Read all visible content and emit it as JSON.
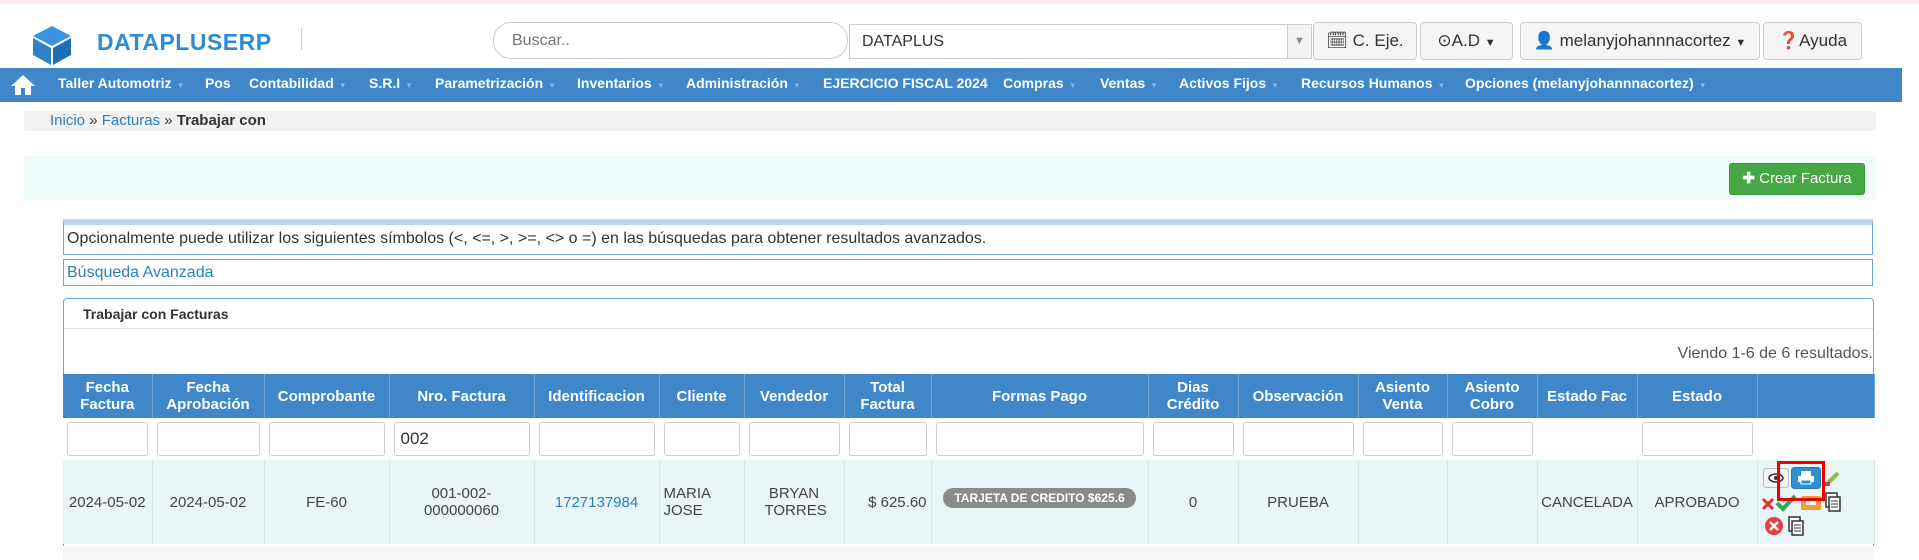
{
  "header": {
    "brand": "DATAPLUSERP",
    "search_placeholder": "Buscar..",
    "company": "DATAPLUS",
    "btn_ejercicio": "C. Eje.",
    "btn_ad": "A.D",
    "btn_user": "melanyjohannnacortez",
    "btn_help": "Ayuda"
  },
  "nav": {
    "items": [
      {
        "label": "Taller Automotriz",
        "caret": true
      },
      {
        "label": "Pos",
        "caret": false
      },
      {
        "label": "Contabilidad",
        "caret": true
      },
      {
        "label": "S.R.I",
        "caret": true
      },
      {
        "label": "Parametrización",
        "caret": true
      },
      {
        "label": "Inventarios",
        "caret": true
      },
      {
        "label": "Administración",
        "caret": true
      },
      {
        "label": "EJERCICIO FISCAL 2024",
        "caret": false
      },
      {
        "label": "Compras",
        "caret": true
      },
      {
        "label": "Ventas",
        "caret": true
      },
      {
        "label": "Activos Fijos",
        "caret": true
      },
      {
        "label": "Recursos Humanos",
        "caret": true
      },
      {
        "label": "Opciones (melanyjohannnacortez)",
        "caret": true
      }
    ]
  },
  "breadcrumb": {
    "home": "Inicio",
    "section": "Facturas",
    "current": "Trabajar con",
    "sep": "»"
  },
  "actions": {
    "create_label": "Crear Factura"
  },
  "hint": "Opcionalmente puede utilizar los siguientes símbolos (<, <=, >, >=, <> o =) en las búsquedas para obtener resultados avanzados.",
  "advanced_search": "Búsqueda Avanzada",
  "panel": {
    "title": "Trabajar con Facturas",
    "summary": "Viendo 1-6 de 6 resultados."
  },
  "table": {
    "headers": [
      "Fecha Factura",
      "Fecha Aprobación",
      "Comprobante",
      "Nro. Factura",
      "Identificacion",
      "Cliente",
      "Vendedor",
      "Total Factura",
      "Formas Pago",
      "Dias Crédito",
      "Observación",
      "Asiento Venta",
      "Asiento Cobro",
      "Estado Fac",
      "Estado",
      ""
    ],
    "filter_nro": "002",
    "rows": [
      {
        "fecha_factura": "2024-05-02",
        "fecha_aprobacion": "2024-05-02",
        "comprobante": "FE-60",
        "nro_factura": "001-002-000000060",
        "identificacion": "1727137984",
        "cliente": "MARIA JOSE",
        "vendedor": "BRYAN TORRES",
        "total": "$ 625.60",
        "formas_pago": "TARJETA DE CREDITO $625.6",
        "dias_credito": "0",
        "observacion": "PRUEBA",
        "asiento_venta": "",
        "asiento_cobro": "",
        "estado_fac": "CANCELADA",
        "estado": "APROBADO"
      }
    ]
  },
  "colors": {
    "brand": "#2e8bd6",
    "nav": "#3f87c8",
    "create": "#45a845",
    "highlight": "#ee0000"
  }
}
